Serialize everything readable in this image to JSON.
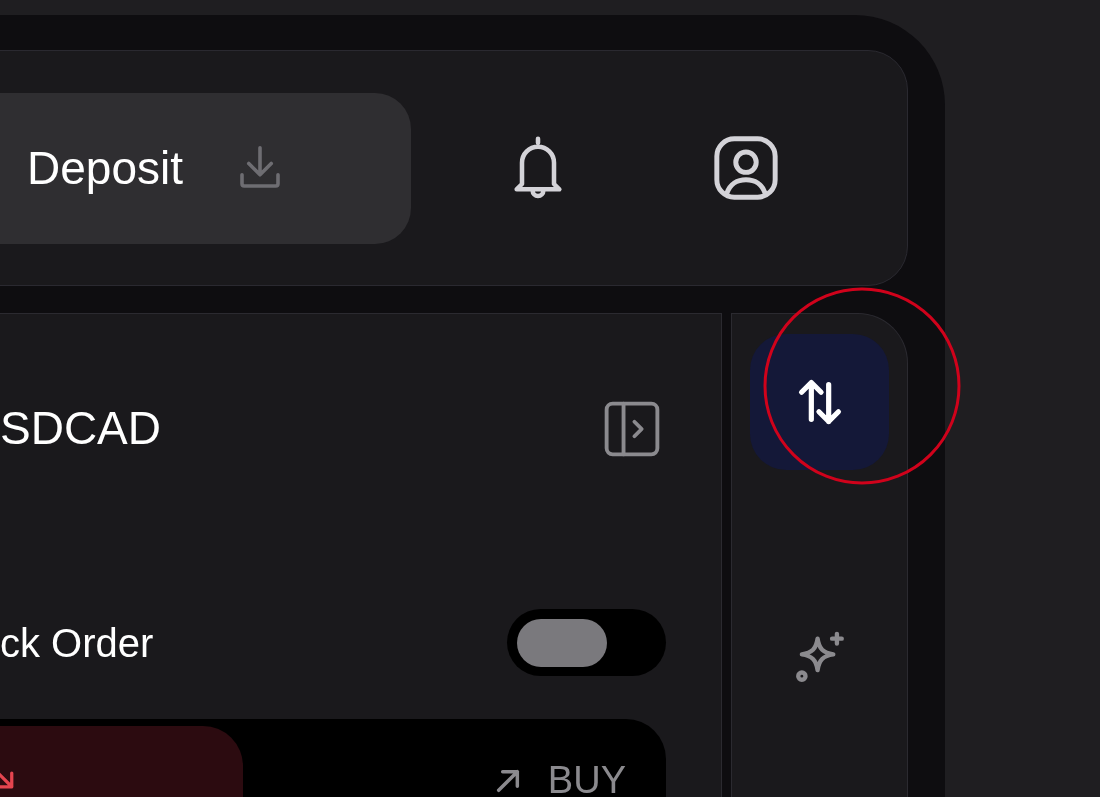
{
  "header": {
    "deposit_button": {
      "label": "Deposit"
    }
  },
  "symbol": "SDCAD",
  "quick_order": {
    "label": "ck Order",
    "on": false
  },
  "order_sides": [
    {
      "kind": "sell",
      "selected": true
    },
    {
      "kind": "buy",
      "label": "BUY",
      "selected": false
    }
  ],
  "rail_items": [
    {
      "kind": "swap",
      "selected": true
    },
    {
      "kind": "sparkle",
      "selected": false
    }
  ]
}
